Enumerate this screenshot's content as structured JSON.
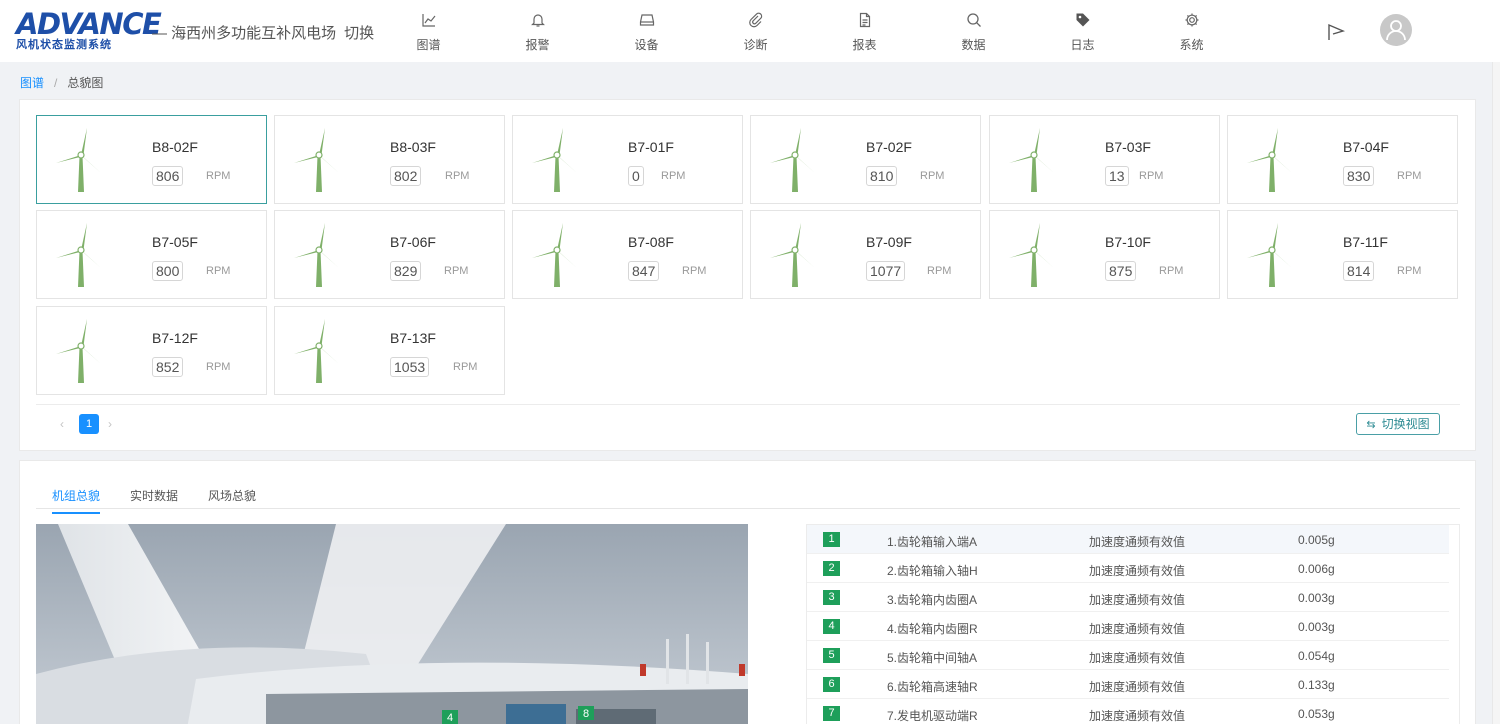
{
  "header": {
    "logo_main": "ADVANCE",
    "logo_sub": "风机状态监测系统",
    "site_title": "— 海西州多功能互补风电场",
    "switch_label": "切换",
    "nav": [
      {
        "label": "图谱",
        "icon": "chart-line-icon"
      },
      {
        "label": "报警",
        "icon": "bell-icon"
      },
      {
        "label": "设备",
        "icon": "hard-drive-icon"
      },
      {
        "label": "诊断",
        "icon": "paperclip-icon"
      },
      {
        "label": "报表",
        "icon": "file-text-icon"
      },
      {
        "label": "数据",
        "icon": "search-icon"
      },
      {
        "label": "日志",
        "icon": "tag-icon"
      },
      {
        "label": "系统",
        "icon": "gear-icon"
      }
    ]
  },
  "breadcrumb": {
    "home": "图谱",
    "separator": "/",
    "current": "总貌图"
  },
  "turbines": [
    {
      "name": "B8-02F",
      "rpm": "806",
      "unit": "RPM"
    },
    {
      "name": "B8-03F",
      "rpm": "802",
      "unit": "RPM"
    },
    {
      "name": "B7-01F",
      "rpm": "0",
      "unit": "RPM"
    },
    {
      "name": "B7-02F",
      "rpm": "810",
      "unit": "RPM"
    },
    {
      "name": "B7-03F",
      "rpm": "13",
      "unit": "RPM"
    },
    {
      "name": "B7-04F",
      "rpm": "830",
      "unit": "RPM"
    },
    {
      "name": "B7-05F",
      "rpm": "800",
      "unit": "RPM"
    },
    {
      "name": "B7-06F",
      "rpm": "829",
      "unit": "RPM"
    },
    {
      "name": "B7-08F",
      "rpm": "847",
      "unit": "RPM"
    },
    {
      "name": "B7-09F",
      "rpm": "1077",
      "unit": "RPM"
    },
    {
      "name": "B7-10F",
      "rpm": "875",
      "unit": "RPM"
    },
    {
      "name": "B7-11F",
      "rpm": "814",
      "unit": "RPM"
    },
    {
      "name": "B7-12F",
      "rpm": "852",
      "unit": "RPM"
    },
    {
      "name": "B7-13F",
      "rpm": "1053",
      "unit": "RPM"
    }
  ],
  "pagination": {
    "prev": "‹",
    "current": "1",
    "next": "›"
  },
  "switch_view": {
    "icon": "⇆",
    "label": "切换视图"
  },
  "tabs": [
    {
      "label": "机组总貌",
      "active": true
    },
    {
      "label": "实时数据",
      "active": false
    },
    {
      "label": "风场总貌",
      "active": false
    }
  ],
  "nacelle_markers": [
    "4",
    "8"
  ],
  "measurements": [
    {
      "idx": "1",
      "name": "1.齿轮箱输入端A",
      "type": "加速度通频有效值",
      "value": "0.005g"
    },
    {
      "idx": "2",
      "name": "2.齿轮箱输入轴H",
      "type": "加速度通频有效值",
      "value": "0.006g"
    },
    {
      "idx": "3",
      "name": "3.齿轮箱内齿圈A",
      "type": "加速度通频有效值",
      "value": "0.003g"
    },
    {
      "idx": "4",
      "name": "4.齿轮箱内齿圈R",
      "type": "加速度通频有效值",
      "value": "0.003g"
    },
    {
      "idx": "5",
      "name": "5.齿轮箱中间轴A",
      "type": "加速度通频有效值",
      "value": "0.054g"
    },
    {
      "idx": "6",
      "name": "6.齿轮箱高速轴R",
      "type": "加速度通频有效值",
      "value": "0.133g"
    },
    {
      "idx": "7",
      "name": "7.发电机驱动端R",
      "type": "加速度通频有效值",
      "value": "0.053g"
    }
  ],
  "colors": {
    "accent": "#1890ff",
    "turbine": "#7fb069",
    "index_badge": "#1e9f5a",
    "active_card_border": "#3a9f9f",
    "logo": "#1e4fa8"
  }
}
